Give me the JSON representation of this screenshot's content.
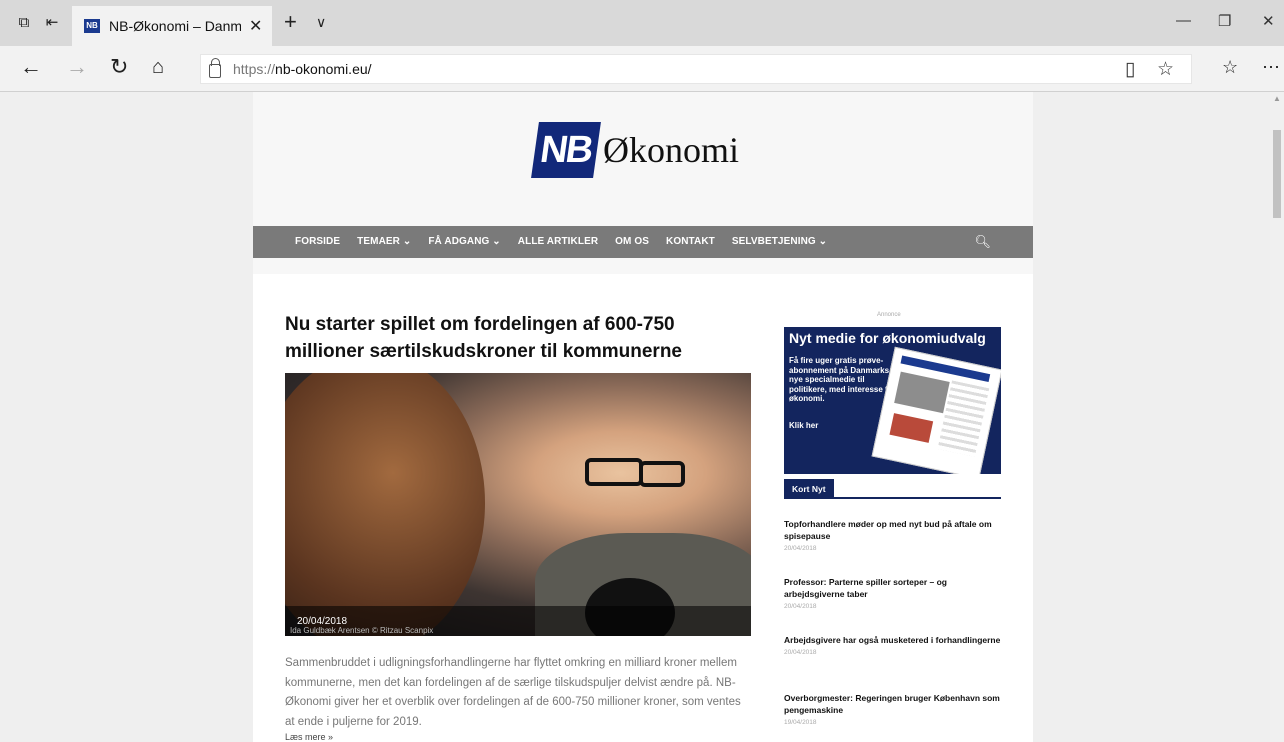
{
  "browser": {
    "tab_title": "NB-Økonomi – Danmar",
    "favicon_text": "NB",
    "url_protocol": "https://",
    "url_host": "nb-okonomi.eu/"
  },
  "site": {
    "logo_mark": "NB",
    "logo_name": "Økonomi",
    "menu": [
      {
        "label": "FORSIDE"
      },
      {
        "label": "TEMAER ⌄"
      },
      {
        "label": "FÅ ADGANG ⌄"
      },
      {
        "label": "ALLE ARTIKLER"
      },
      {
        "label": "OM OS"
      },
      {
        "label": "KONTAKT"
      },
      {
        "label": "SELVBETJENING ⌄"
      }
    ]
  },
  "article": {
    "headline": "Nu starter spillet om fordelingen af 600-750 millioner særtilskudskroner til kommunerne",
    "image_date": "20/04/2018",
    "image_credit": "Ida Guldbæk Arentsen © Ritzau Scanpix",
    "excerpt": "Sammenbruddet i udligningsforhandlingerne har flyttet omkring en milliard kroner mellem kommunerne, men det kan fordelingen af de særlige tilskudspuljer delvist ændre på. NB-Økonomi giver her et overblik over fordelingen af de 600-750 millioner kroner, som ventes at ende i puljerne for 2019.",
    "read_more": "Læs mere »"
  },
  "ad": {
    "label": "Annonce",
    "title": "Nyt medie for økonomiudvalg",
    "body": "Få fire uger gratis prøve-abonnement på Danmarks nye specialmedie til politikere, med interesse for økonomi.",
    "cta": "Klik her"
  },
  "kort_nyt": {
    "heading": "Kort Nyt",
    "items": [
      {
        "title": "Topforhandlere møder op med nyt bud på aftale om spisepause",
        "date": "20/04/2018"
      },
      {
        "title": "Professor: Parterne spiller sorteper – og arbejdsgiverne taber",
        "date": "20/04/2018"
      },
      {
        "title": "Arbejdsgivere har også musketered i forhandlingerne",
        "date": "20/04/2018"
      },
      {
        "title": "Overborgmester: Regeringen bruger København som pengemaskine",
        "date": "19/04/2018"
      }
    ]
  }
}
